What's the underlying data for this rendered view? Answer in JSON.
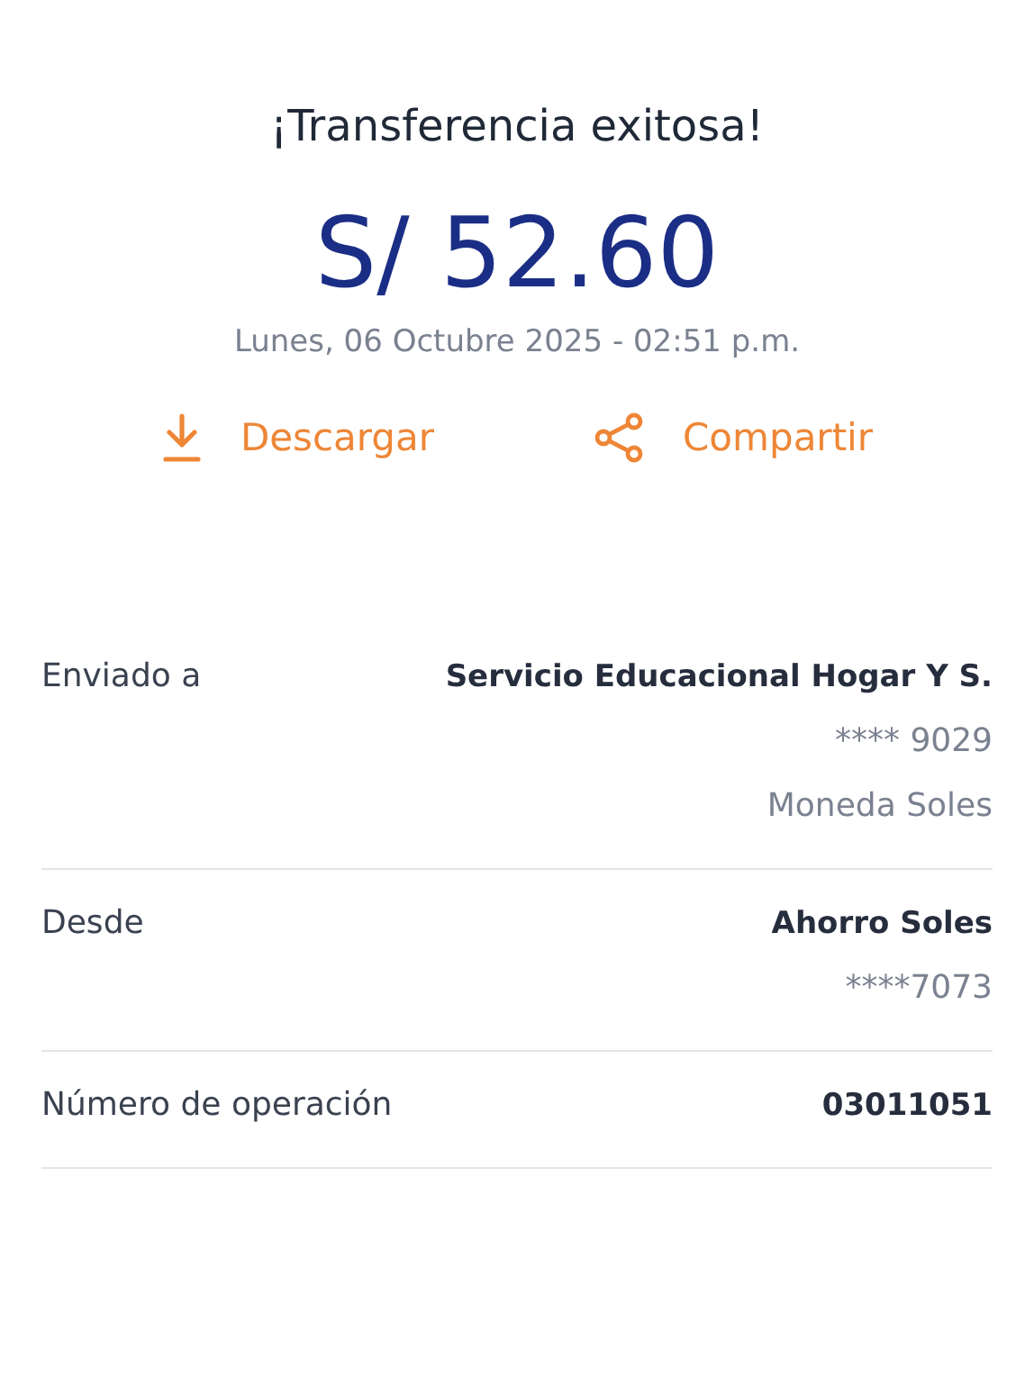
{
  "title": "¡Transferencia exitosa!",
  "amount": "S/ 52.60",
  "date": "Lunes, 06 Octubre 2025 - 02:51 p.m.",
  "actions": [
    {
      "kind": "download",
      "label": "Descargar"
    },
    {
      "kind": "share",
      "label": "Compartir"
    }
  ],
  "details": [
    {
      "label": "Enviado a",
      "values": [
        {
          "kind": "primary",
          "text": "Servicio Educacional Hogar Y S."
        },
        {
          "kind": "secondary",
          "text": "**** 9029"
        },
        {
          "kind": "secondary",
          "text": "Moneda Soles"
        }
      ]
    },
    {
      "label": "Desde",
      "values": [
        {
          "kind": "primary",
          "text": "Ahorro Soles"
        },
        {
          "kind": "secondary",
          "text": "****7073"
        }
      ]
    },
    {
      "label": "Número de operación",
      "values": [
        {
          "kind": "primary",
          "text": "03011051"
        }
      ]
    }
  ]
}
